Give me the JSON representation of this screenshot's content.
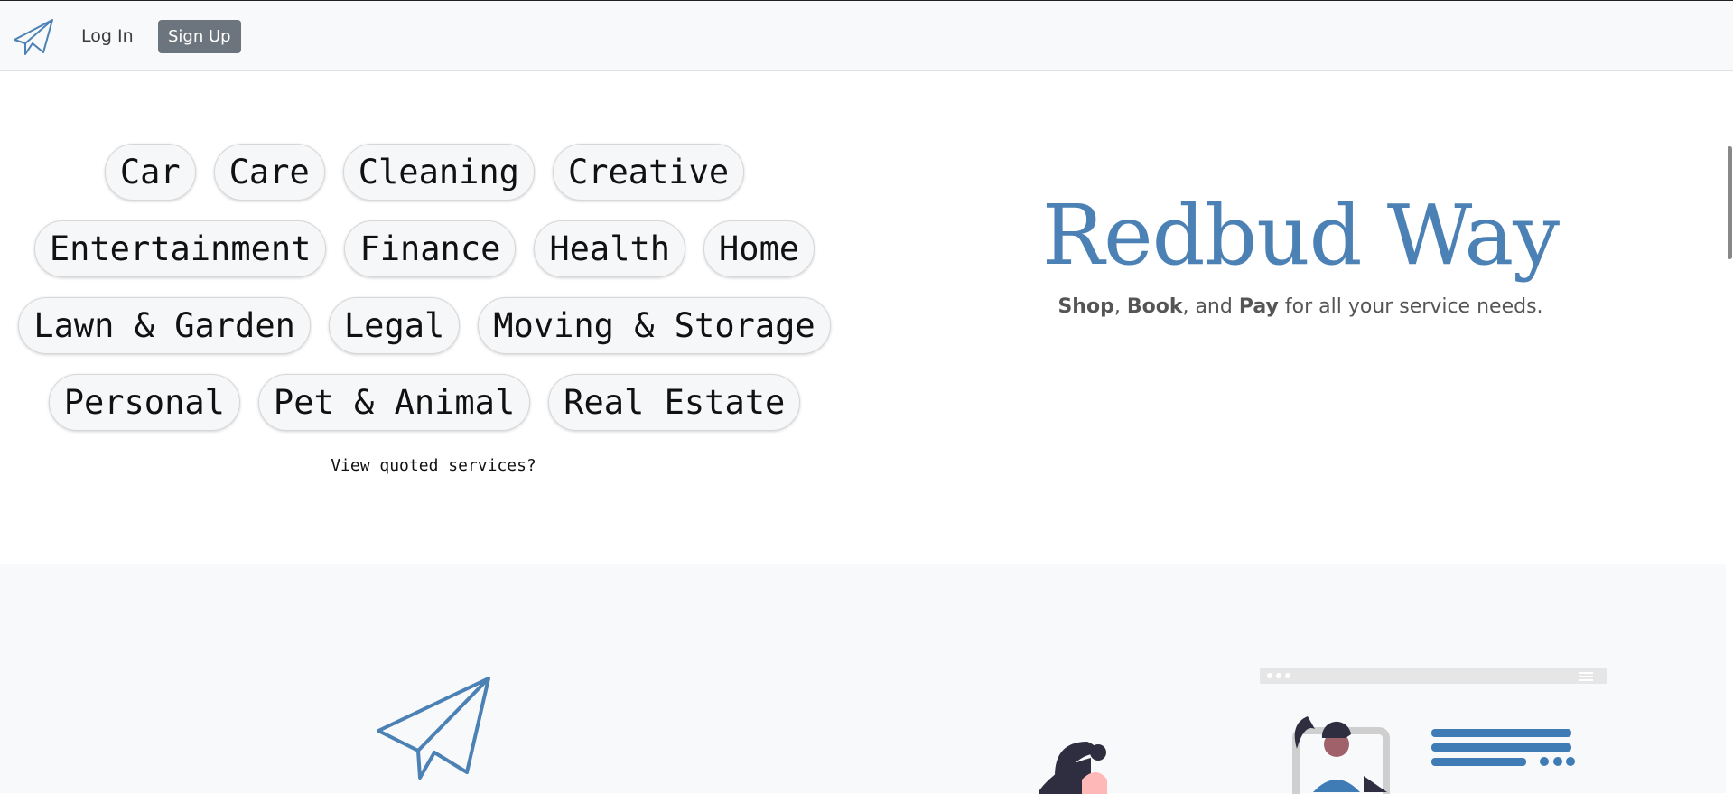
{
  "nav": {
    "login_label": "Log In",
    "signup_label": "Sign Up",
    "logo_icon": "paper-plane-icon"
  },
  "categories": {
    "row1": [
      "Car",
      "Care",
      "Cleaning",
      "Creative"
    ],
    "row2": [
      "Entertainment",
      "Finance",
      "Health",
      "Home"
    ],
    "row3": [
      "Lawn & Garden",
      "Legal",
      "Moving & Storage"
    ],
    "row4": [
      "Personal",
      "Pet & Animal",
      "Real Estate"
    ]
  },
  "quoted_link": "View quoted services?",
  "brand": {
    "title": "Redbud Way",
    "tagline_shop": "Shop",
    "tagline_sep1": ", ",
    "tagline_book": "Book",
    "tagline_sep2": ", and ",
    "tagline_pay": "Pay",
    "tagline_rest": " for all your service needs."
  },
  "colors": {
    "accent": "#4b81b5",
    "navbar": "#f8f9fa",
    "signup": "#6c757d"
  }
}
